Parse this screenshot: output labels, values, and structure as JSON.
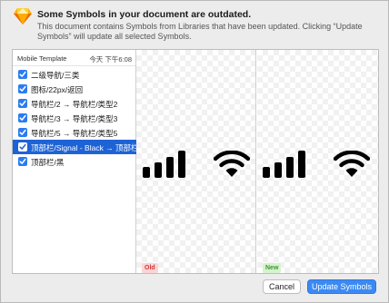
{
  "dialog": {
    "title": "Some Symbols in your document are outdated.",
    "message": "This document contains Symbols from Libraries that have been updated. Clicking “Update Symbols” will update all selected Symbols.",
    "app_icon": "sketch-diamond-icon"
  },
  "list": {
    "header": "Mobile Template",
    "time": "今天 下午6:08",
    "items": [
      {
        "label": "二级导航/三类",
        "checked": true,
        "selected": false
      },
      {
        "label": "图标/22px/返回",
        "checked": true,
        "selected": false
      },
      {
        "label": "导航栏/2 → 导航栏/类型2",
        "checked": true,
        "selected": false
      },
      {
        "label": "导航栏/3 → 导航栏/类型3",
        "checked": true,
        "selected": false
      },
      {
        "label": "导航栏/5 → 导航栏/类型5",
        "checked": true,
        "selected": false
      },
      {
        "label": "顶部栏/Signal - Black → 顶部栏/Signal - Black",
        "checked": true,
        "selected": true
      },
      {
        "label": "顶部栏/黑",
        "checked": true,
        "selected": false
      }
    ]
  },
  "preview": {
    "old_label": "Old",
    "new_label": "New",
    "icons": [
      "signal-bars-icon",
      "wifi-icon"
    ]
  },
  "buttons": {
    "cancel": "Cancel",
    "update": "Update Symbols"
  },
  "colors": {
    "accent": "#3b8af4",
    "selection": "#1e63d6",
    "old_tag": "#d23a3a",
    "new_tag": "#3b9a2f"
  }
}
